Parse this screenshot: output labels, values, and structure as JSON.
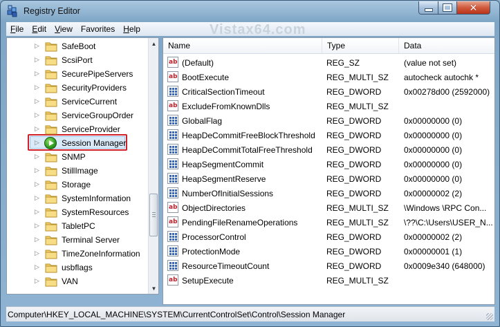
{
  "window": {
    "title": "Registry Editor"
  },
  "menu": [
    {
      "key": "F",
      "rest": "ile"
    },
    {
      "key": "E",
      "rest": "dit"
    },
    {
      "key": "V",
      "rest": "iew"
    },
    {
      "key": "",
      "rest": "Favorites"
    },
    {
      "key": "H",
      "rest": "elp"
    }
  ],
  "watermark": "Vistax64.com",
  "tree": {
    "items": [
      {
        "label": "SafeBoot"
      },
      {
        "label": "ScsiPort"
      },
      {
        "label": "SecurePipeServers"
      },
      {
        "label": "SecurityProviders"
      },
      {
        "label": "ServiceCurrent"
      },
      {
        "label": "ServiceGroupOrder"
      },
      {
        "label": "ServiceProvider"
      },
      {
        "label": "Session Manager",
        "selected": true
      },
      {
        "label": "SNMP"
      },
      {
        "label": "StillImage"
      },
      {
        "label": "Storage"
      },
      {
        "label": "SystemInformation"
      },
      {
        "label": "SystemResources"
      },
      {
        "label": "TabletPC"
      },
      {
        "label": "Terminal Server"
      },
      {
        "label": "TimeZoneInformation"
      },
      {
        "label": "usbflags"
      },
      {
        "label": "VAN"
      }
    ]
  },
  "list": {
    "columns": [
      "Name",
      "Type",
      "Data"
    ],
    "rows": [
      {
        "icon": "string",
        "name": "(Default)",
        "type": "REG_SZ",
        "data": "(value not set)"
      },
      {
        "icon": "string",
        "name": "BootExecute",
        "type": "REG_MULTI_SZ",
        "data": "autocheck autochk *"
      },
      {
        "icon": "dword",
        "name": "CriticalSectionTimeout",
        "type": "REG_DWORD",
        "data": "0x00278d00 (2592000)"
      },
      {
        "icon": "string",
        "name": "ExcludeFromKnownDlls",
        "type": "REG_MULTI_SZ",
        "data": ""
      },
      {
        "icon": "dword",
        "name": "GlobalFlag",
        "type": "REG_DWORD",
        "data": "0x00000000 (0)"
      },
      {
        "icon": "dword",
        "name": "HeapDeCommitFreeBlockThreshold",
        "type": "REG_DWORD",
        "data": "0x00000000 (0)"
      },
      {
        "icon": "dword",
        "name": "HeapDeCommitTotalFreeThreshold",
        "type": "REG_DWORD",
        "data": "0x00000000 (0)"
      },
      {
        "icon": "dword",
        "name": "HeapSegmentCommit",
        "type": "REG_DWORD",
        "data": "0x00000000 (0)"
      },
      {
        "icon": "dword",
        "name": "HeapSegmentReserve",
        "type": "REG_DWORD",
        "data": "0x00000000 (0)"
      },
      {
        "icon": "dword",
        "name": "NumberOfInitialSessions",
        "type": "REG_DWORD",
        "data": "0x00000002 (2)"
      },
      {
        "icon": "string",
        "name": "ObjectDirectories",
        "type": "REG_MULTI_SZ",
        "data": "\\Windows \\RPC Con..."
      },
      {
        "icon": "string",
        "name": "PendingFileRenameOperations",
        "type": "REG_MULTI_SZ",
        "data": "\\??\\C:\\Users\\USER_N..."
      },
      {
        "icon": "dword",
        "name": "ProcessorControl",
        "type": "REG_DWORD",
        "data": "0x00000002 (2)"
      },
      {
        "icon": "dword",
        "name": "ProtectionMode",
        "type": "REG_DWORD",
        "data": "0x00000001 (1)"
      },
      {
        "icon": "dword",
        "name": "ResourceTimeoutCount",
        "type": "REG_DWORD",
        "data": "0x0009e340 (648000)"
      },
      {
        "icon": "string",
        "name": "SetupExecute",
        "type": "REG_MULTI_SZ",
        "data": ""
      }
    ]
  },
  "status": {
    "path": "Computer\\HKEY_LOCAL_MACHINE\\SYSTEM\\CurrentControlSet\\Control\\Session Manager"
  },
  "colors": {
    "selection_outline": "#d0202a",
    "string_icon": "#c0202a",
    "dword_icon": "#3a66b8"
  }
}
